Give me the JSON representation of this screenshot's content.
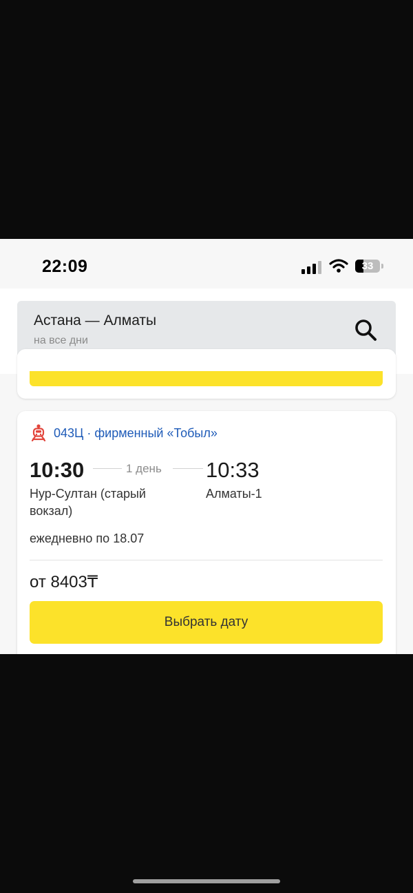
{
  "status_bar": {
    "time": "22:09",
    "battery": "33",
    "icons": [
      "cellular-signal-icon",
      "wifi-icon",
      "battery-icon"
    ]
  },
  "search": {
    "route": "Астана — Алматы",
    "dates": "на все дни",
    "icon": "search-icon"
  },
  "train": {
    "icon": "train-icon",
    "name": "043Ц · фирменный «Тобыл»",
    "departure_time": "10:30",
    "duration": "1 день",
    "arrival_time": "10:33",
    "departure_station": "Нур-Султан (старый вокзал)",
    "arrival_station": "Алматы-1",
    "schedule": "ежедневно по 18.07",
    "price": "от 8403₸",
    "button_label": "Выбрать дату"
  },
  "colors": {
    "accent_yellow": "#fce22a",
    "link_blue": "#1e5bb8",
    "train_icon_red": "#e2453c"
  }
}
